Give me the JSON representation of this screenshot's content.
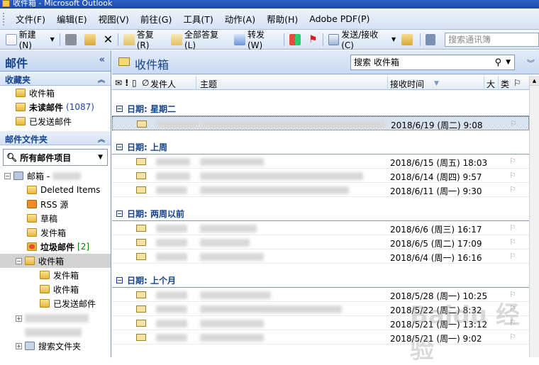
{
  "window": {
    "title": "收件箱 - Microsoft Outlook"
  },
  "menu": [
    "文件(F)",
    "编辑(E)",
    "视图(V)",
    "前往(G)",
    "工具(T)",
    "动作(A)",
    "帮助(H)",
    "Adobe PDF(P)"
  ],
  "toolbar": {
    "new_label": "新建(N)",
    "reply_label": "答复(R)",
    "reply_all_label": "全部答复(L)",
    "forward_label": "转发(W)",
    "send_receive_label": "发送/接收(C)",
    "search_placeholder": "搜索通讯簿"
  },
  "nav": {
    "header": "邮件",
    "favorites_title": "收藏夹",
    "favorites": [
      {
        "label": "收件箱"
      },
      {
        "label": "未读邮件",
        "count": "(1087)"
      },
      {
        "label": "已发送邮件"
      }
    ],
    "folders_title": "邮件文件夹",
    "all_items": "所有邮件项目",
    "mailbox_label": "邮箱 -",
    "folders": [
      {
        "label": "Deleted Items"
      },
      {
        "label": "RSS 源"
      },
      {
        "label": "草稿"
      },
      {
        "label": "发件箱"
      },
      {
        "label": "垃圾邮件",
        "count": "[2]"
      },
      {
        "label": "收件箱"
      }
    ],
    "subfolders": [
      {
        "label": "发件箱"
      },
      {
        "label": "收件箱"
      },
      {
        "label": "已发送邮件"
      }
    ],
    "search_folders": "搜索文件夹"
  },
  "main": {
    "title": "收件箱",
    "search_value": "搜索 收件箱",
    "columns": {
      "sender": "发件人",
      "subject": "主题",
      "received": "接收时间",
      "size": "大",
      "flag": "类"
    },
    "groups": [
      {
        "label": "日期: 星期二",
        "rows": [
          {
            "date": "2018/6/19 (周二) 9:08"
          }
        ]
      },
      {
        "label": "日期: 上周",
        "rows": [
          {
            "date": "2018/6/15 (周五) 18:03"
          },
          {
            "date": "2018/6/14 (周四) 9:57"
          },
          {
            "date": "2018/6/11 (周一) 9:30"
          }
        ]
      },
      {
        "label": "日期: 两周以前",
        "rows": [
          {
            "date": "2018/6/6 (周三) 16:17"
          },
          {
            "date": "2018/6/5 (周二) 17:09"
          },
          {
            "date": "2018/6/4 (周一) 16:16"
          }
        ]
      },
      {
        "label": "日期: 上个月",
        "rows": [
          {
            "date": "2018/5/28 (周一) 10:25"
          },
          {
            "date": "2018/5/22 (周二) 8:32"
          },
          {
            "date": "2018/5/21 (周一) 13:12"
          },
          {
            "date": "2018/5/21 (周一) 9:02"
          }
        ]
      }
    ]
  },
  "watermark": "Baidu 经验",
  "colors": {
    "accent": "#15428b",
    "header_bg": "#c9daf1",
    "selection": "#d9e2ef"
  }
}
